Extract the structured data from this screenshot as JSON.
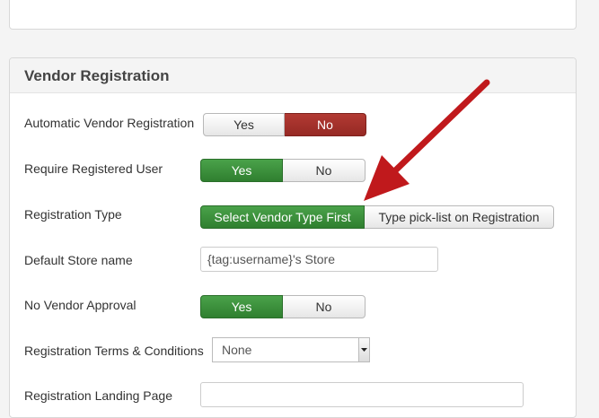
{
  "section": {
    "title": "Vendor Registration"
  },
  "fields": {
    "auto_vendor": {
      "label": "Automatic Vendor Registration",
      "options": [
        "Yes",
        "No"
      ],
      "selected": "No"
    },
    "require_user": {
      "label": "Require Registered User",
      "options": [
        "Yes",
        "No"
      ],
      "selected": "Yes"
    },
    "reg_type": {
      "label": "Registration Type",
      "options": [
        "Select Vendor Type First",
        "Type pick-list on Registration"
      ],
      "selected": "Select Vendor Type First"
    },
    "store_name": {
      "label": "Default Store name",
      "value": "{tag:username}'s Store"
    },
    "no_approval": {
      "label": "No Vendor Approval",
      "options": [
        "Yes",
        "No"
      ],
      "selected": "Yes"
    },
    "terms": {
      "label": "Registration Terms & Conditions",
      "value": "None"
    },
    "landing": {
      "label": "Registration Landing Page",
      "value": ""
    }
  },
  "colors": {
    "selected_yes": "#3c8f3c",
    "selected_no": "#a0302a",
    "annotation_arrow": "#c0191c"
  },
  "icons": {
    "annotation": "red-pointer-arrow",
    "select": "caret-down-icon"
  }
}
